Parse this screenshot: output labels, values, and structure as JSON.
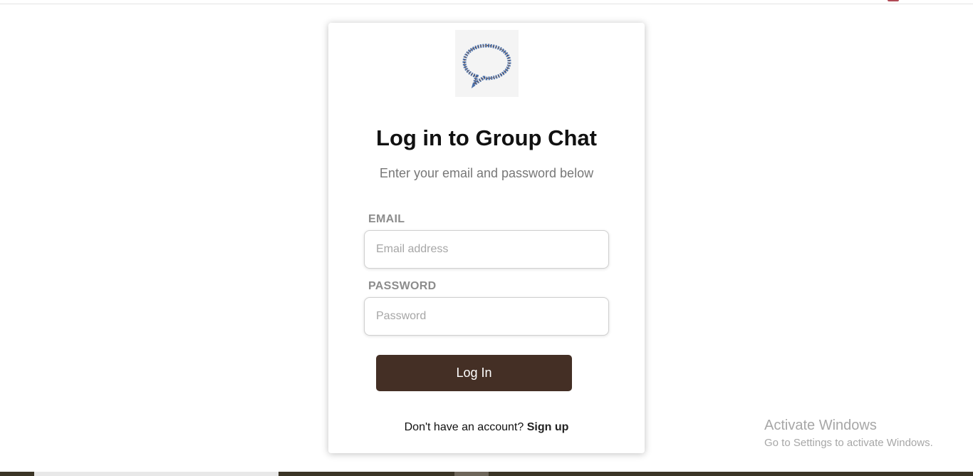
{
  "page": {
    "colors": {
      "accent_button": "#442f25",
      "label_gray": "#8c8c8c",
      "subtitle_gray": "#777777",
      "watermark_gray": "#a7a7a7"
    }
  },
  "login": {
    "logo_icon": "speech-bubble-icon",
    "title": "Log in to Group Chat",
    "subtitle": "Enter your email and password below",
    "email": {
      "label": "EMAIL",
      "placeholder": "Email address",
      "value": ""
    },
    "password": {
      "label": "PASSWORD",
      "placeholder": "Password",
      "value": ""
    },
    "submit_label": "Log In",
    "signup_prompt": "Don't have an account?",
    "signup_link": "Sign up"
  },
  "watermark": {
    "title": "Activate Windows",
    "subtitle": "Go to Settings to activate Windows."
  }
}
